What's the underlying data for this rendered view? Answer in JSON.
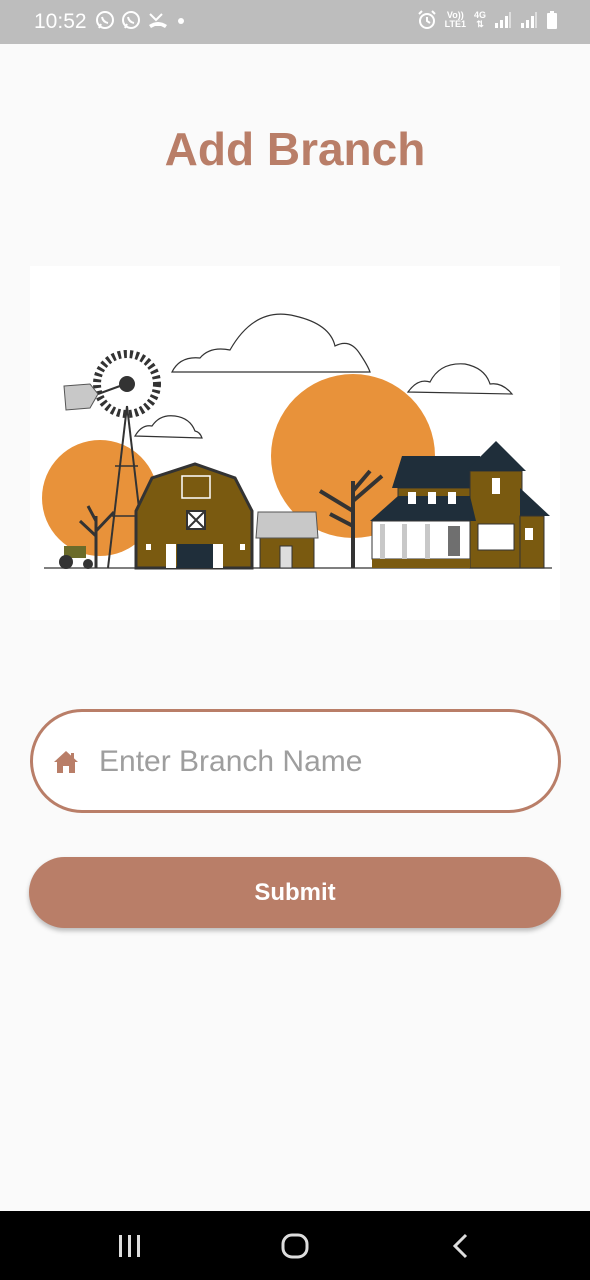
{
  "status_bar": {
    "time": "10:52",
    "network_top": "Vo))",
    "network_mid": "LTE1",
    "network_type": "4G"
  },
  "page": {
    "title": "Add Branch"
  },
  "form": {
    "branch_placeholder": "Enter Branch Name",
    "branch_value": "",
    "submit_label": "Submit"
  },
  "colors": {
    "accent": "#b97e68",
    "orange": "#e8923a",
    "brown": "#7a5a10"
  },
  "icons": {
    "input": "home-icon",
    "nav": [
      "recent-apps-icon",
      "home-nav-icon",
      "back-icon"
    ]
  }
}
